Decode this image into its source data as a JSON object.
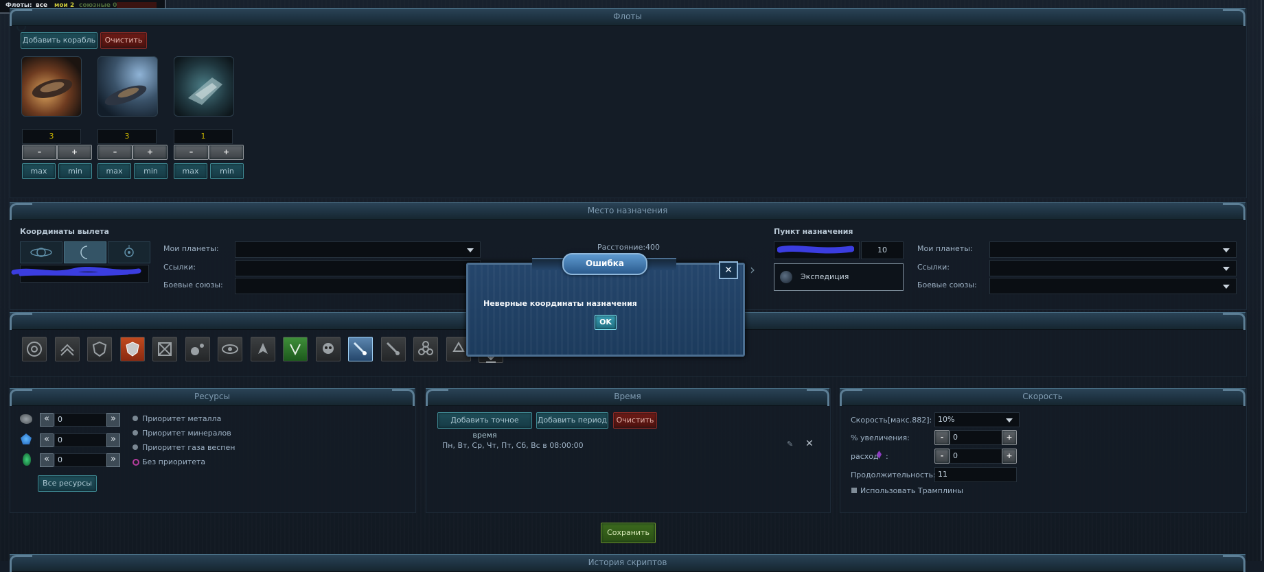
{
  "topbar": {
    "label": "Флоты:",
    "all": "все",
    "mine": "мои 2",
    "allied": "союзные 0"
  },
  "fleets": {
    "title": "Флоты",
    "add_ship": "Добавить корабль",
    "clear": "Очистить",
    "ships": [
      {
        "count": "3",
        "minus": "–",
        "plus": "+",
        "max": "max",
        "min": "min"
      },
      {
        "count": "3",
        "minus": "–",
        "plus": "+",
        "max": "max",
        "min": "min"
      },
      {
        "count": "1",
        "minus": "–",
        "plus": "+",
        "max": "max",
        "min": "min"
      }
    ]
  },
  "destination": {
    "title": "Место назначения",
    "departure_title": "Координаты вылета",
    "my_planets": "Мои планеты:",
    "links": "Ссылки:",
    "alliances": "Боевые союзы:",
    "distance_label": "Расстояние:",
    "distance_value": "400",
    "target_title": "Пункт назначения",
    "target_slot": "10",
    "mission_name": "Экспедиция",
    "target_my_planets": "Мои планеты:",
    "target_links": "Ссылки:",
    "target_alliances": "Боевые союзы:"
  },
  "resources": {
    "title": "Ресурсы",
    "values": [
      "0",
      "0",
      "0"
    ],
    "left_arrow": "«",
    "right_arrow": "»",
    "priorities": [
      "Приоритет металла",
      "Приоритет минералов",
      "Приоритет газа веспен",
      "Без приоритета"
    ],
    "all_resources": "Все ресурсы"
  },
  "time": {
    "title": "Время",
    "add_exact": "Добавить точное время",
    "add_period": "Добавить период",
    "clear": "Очистить",
    "schedule": "Пн, Вт, Ср, Чт, Пт, Сб, Вс в 08:00:00"
  },
  "speed": {
    "title": "Скорость",
    "speed_label": "Скорость[макс.882]:",
    "speed_value": "10%",
    "increase_label": "% увеличения:",
    "increase_value": "0",
    "consumption_label": "расход",
    "consumption_colon": ":",
    "consumption_value": "0",
    "duration_label": "Продолжительность:",
    "duration_value": "11",
    "trampoline": "Использовать Трамплины",
    "minus": "-",
    "plus": "+"
  },
  "save": "Сохранить",
  "bottom_title": "История скриптов",
  "modal": {
    "title": "Ошибка",
    "message": "Неверные координаты назначения",
    "ok": "OK",
    "close": "✕"
  },
  "colors": {
    "ship_count": "#c9b400",
    "modal_bg": "#25466c",
    "accent": "#3f8a94"
  },
  "mission_icons": [
    "target-icon",
    "chevrons-up-icon",
    "shield-check-icon",
    "shield-red-icon",
    "crossed-box-icon",
    "orbit-balls-icon",
    "eye-icon",
    "ship-icon",
    "trident-icon",
    "skull-icon",
    "comet-icon",
    "comet-dim-icon",
    "biohazard-icon",
    "recycle-icon",
    "download-icon"
  ]
}
